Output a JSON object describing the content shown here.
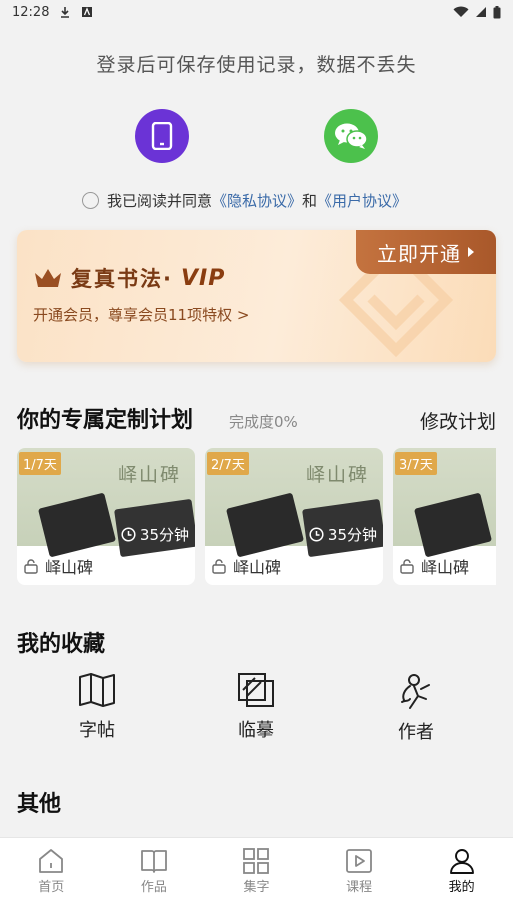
{
  "status": {
    "time": "12:28"
  },
  "login": {
    "tip": "登录后可保存使用记录，数据不丢失",
    "agree_prefix": "我已阅读并同意",
    "privacy": "《隐私协议》",
    "and": "和",
    "user": "《用户协议》"
  },
  "vip": {
    "brand": "复真书法·",
    "vip_word": "VIP",
    "subtitle": "开通会员，尊享会员11项特权 >",
    "open": "立即开通"
  },
  "plan": {
    "title": "你的专属定制计划",
    "progress": "完成度0%",
    "edit": "修改计划",
    "cards": [
      {
        "badge": "1/7天",
        "image_title": "峄山碑",
        "duration": "35分钟",
        "name": "峄山碑"
      },
      {
        "badge": "2/7天",
        "image_title": "峄山碑",
        "duration": "35分钟",
        "name": "峄山碑"
      },
      {
        "badge": "3/7天",
        "name": "峄山碑"
      }
    ]
  },
  "favorites": {
    "title": "我的收藏",
    "items": [
      {
        "label": "字帖",
        "icon": "map-icon"
      },
      {
        "label": "临摹",
        "icon": "copy-squares-icon"
      },
      {
        "label": "作者",
        "icon": "person-calligraphy-icon"
      }
    ]
  },
  "other": {
    "title": "其他"
  },
  "tabs": [
    {
      "label": "首页",
      "icon": "home-icon"
    },
    {
      "label": "作品",
      "icon": "book-icon"
    },
    {
      "label": "集字",
      "icon": "grid-icon"
    },
    {
      "label": "课程",
      "icon": "play-icon"
    },
    {
      "label": "我的",
      "icon": "user-icon",
      "active": true
    }
  ],
  "colors": {
    "phone": "#6b33d6",
    "wechat": "#4cc14c",
    "link": "#3a6aa8",
    "vip_button": "#b66433"
  }
}
